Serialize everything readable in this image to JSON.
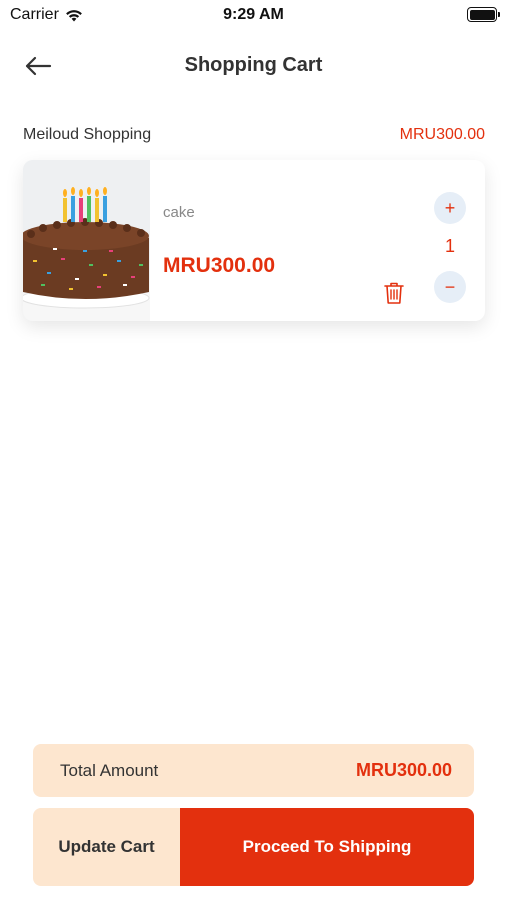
{
  "status_bar": {
    "carrier": "Carrier",
    "time": "9:29 AM"
  },
  "nav": {
    "title": "Shopping Cart"
  },
  "store": {
    "name": "Meiloud Shopping",
    "subtotal": "MRU300.00"
  },
  "cart_items": [
    {
      "name": "cake",
      "price": "MRU300.00",
      "quantity": "1",
      "plus": "+",
      "minus": "−"
    }
  ],
  "summary": {
    "total_label": "Total Amount",
    "total_value": "MRU300.00"
  },
  "actions": {
    "update_cart": "Update Cart",
    "proceed": "Proceed To Shipping"
  },
  "colors": {
    "accent": "#e3300e",
    "panel": "#fde6cf",
    "qty_bg": "#e6eef7"
  }
}
